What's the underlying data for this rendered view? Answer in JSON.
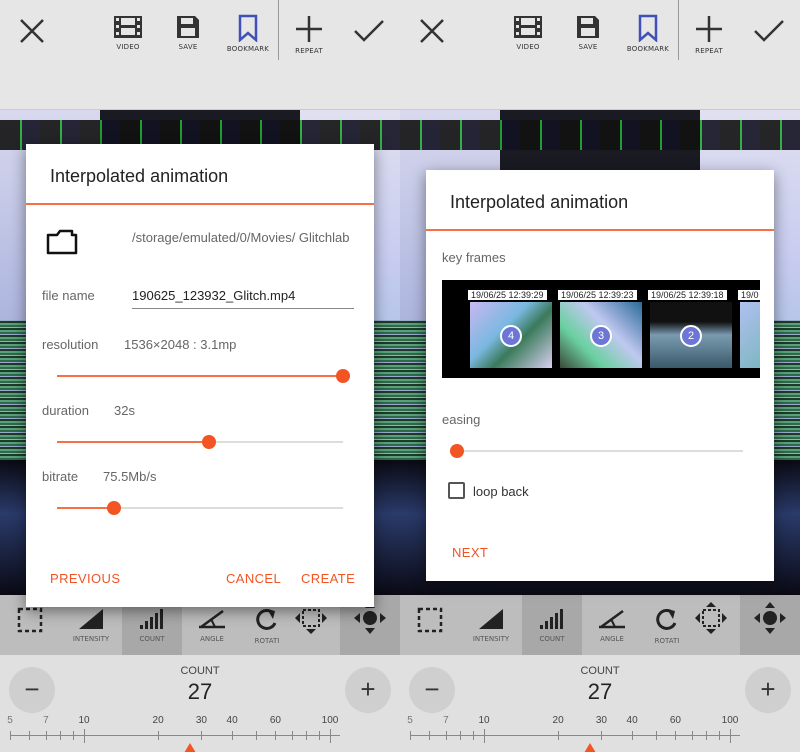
{
  "topbar": {
    "video_label": "VIDEO",
    "save_label": "SAVE",
    "bookmark_label": "BOOKMARK",
    "repeat_label": "REPEAT"
  },
  "tools": {
    "intensity_label": "INTENSITY",
    "count_label": "COUNT",
    "angle_label": "ANGLE",
    "rotate_label": "ROTATI"
  },
  "counter": {
    "label": "COUNT",
    "value": "27",
    "minus": "−",
    "plus": "+",
    "scale": [
      "5",
      "7",
      "10",
      "20",
      "30",
      "40",
      "60",
      "100"
    ],
    "pointer_value": 27
  },
  "left_dialog": {
    "title": "Interpolated animation",
    "path": "/storage/emulated/0/Movies/ Glitchlab",
    "file_name_label": "file name",
    "file_name_value": "190625_123932_Glitch.mp4",
    "resolution_label": "resolution",
    "resolution_value": "1536×2048 : 3.1mp",
    "resolution_level": 1.0,
    "duration_label": "duration",
    "duration_value": "32s",
    "duration_level": 0.53,
    "bitrate_label": "bitrate",
    "bitrate_value": "75.5Mb/s",
    "bitrate_level": 0.2,
    "previous_label": "PREVIOUS",
    "cancel_label": "CANCEL",
    "create_label": "CREATE"
  },
  "right_dialog": {
    "title": "Interpolated animation",
    "key_frames_label": "key frames",
    "frames": [
      {
        "timestamp": "19/06/25 12:39:29",
        "badge": "4"
      },
      {
        "timestamp": "19/06/25 12:39:23",
        "badge": "3"
      },
      {
        "timestamp": "19/06/25 12:39:18",
        "badge": "2"
      },
      {
        "timestamp": "19/0",
        "badge": ""
      }
    ],
    "easing_label": "easing",
    "easing_level": 0.0,
    "loop_back_label": "loop back",
    "loop_back_checked": false,
    "next_label": "NEXT"
  },
  "colors": {
    "accent": "#f25424",
    "divider": "#f37049",
    "badge": "#6b76d6"
  }
}
